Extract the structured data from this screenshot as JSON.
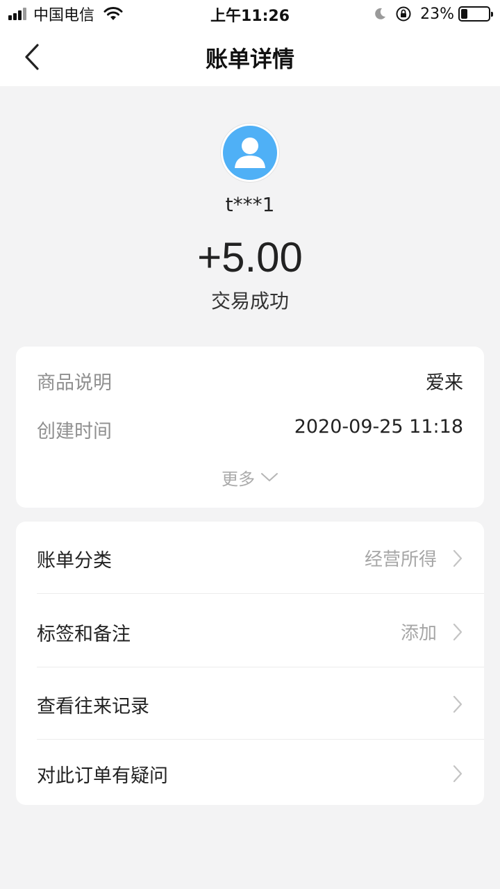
{
  "status_bar": {
    "carrier": "中国电信",
    "time": "上午11:26",
    "battery_percent": "23%",
    "battery_level": 0.23
  },
  "nav": {
    "title": "账单详情",
    "back_icon": "chevron-left-icon"
  },
  "header": {
    "avatar_icon": "user-avatar-icon",
    "avatar_color": "#4fb0f6",
    "username": "t***1",
    "amount": "+5.00",
    "status": "交易成功"
  },
  "details": {
    "rows": [
      {
        "label": "商品说明",
        "value": "爱来"
      },
      {
        "label": "创建时间",
        "value": "2020-09-25 11:18"
      }
    ],
    "more_label": "更多"
  },
  "actions": [
    {
      "label": "账单分类",
      "value": "经营所得"
    },
    {
      "label": "标签和备注",
      "value": "添加"
    },
    {
      "label": "查看往来记录",
      "value": ""
    },
    {
      "label": "对此订单有疑问",
      "value": ""
    }
  ]
}
